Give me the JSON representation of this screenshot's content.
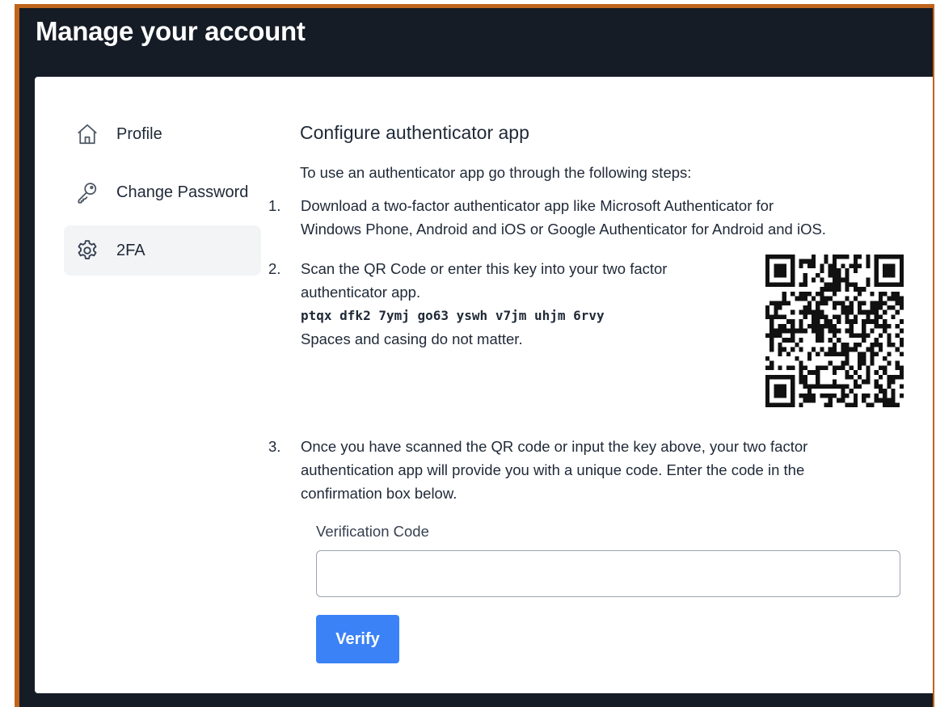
{
  "app": {
    "title": "Manage your account"
  },
  "sidebar": {
    "items": [
      {
        "label": "Profile",
        "icon": "home-icon",
        "active": false
      },
      {
        "label": "Change Password",
        "icon": "key-icon",
        "active": false
      },
      {
        "label": "2FA",
        "icon": "gear-icon",
        "active": true
      }
    ]
  },
  "main": {
    "heading": "Configure authenticator app",
    "intro": "To use an authenticator app go through the following steps:",
    "steps": [
      {
        "number": "1.",
        "line1": "Download a two-factor authenticator app like Microsoft Authenticator for",
        "line2": "Windows Phone, Android and iOS or Google Authenticator for Android and iOS."
      },
      {
        "number": "2.",
        "line1": "Scan the QR Code or enter this key into your two factor",
        "line2": "authenticator app.",
        "key": "ptqx dfk2 7ymj go63 yswh v7jm uhjm 6rvy",
        "note": "Spaces and casing do not matter."
      },
      {
        "number": "3.",
        "line1": "Once you have scanned the QR code or input the key above, your two factor",
        "line2": "authentication app will provide you with a unique code. Enter the code in the",
        "line3": "confirmation box below."
      }
    ],
    "verification": {
      "label": "Verification Code",
      "value": "",
      "placeholder": "",
      "button_label": "Verify"
    }
  },
  "colors": {
    "header_bg": "#151c26",
    "frame_border": "#c0641c",
    "accent": "#3b82f6",
    "active_nav_bg": "#f2f4f6"
  }
}
